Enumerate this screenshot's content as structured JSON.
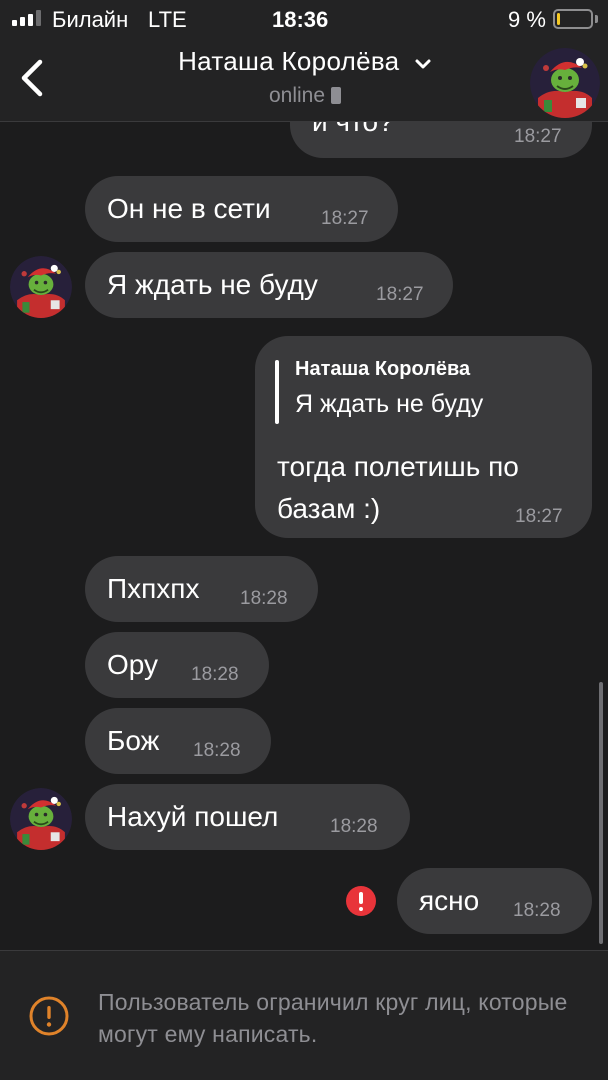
{
  "status_bar": {
    "carrier": "Билайн",
    "network": "LTE",
    "time": "18:36",
    "battery_percent": "9 %",
    "battery_level": 0.09,
    "battery_color": "#f5c924",
    "signal_bars_filled": 3,
    "signal_bars_total": 4
  },
  "header": {
    "back_icon": "chevron-left-icon",
    "title": "Наташа Королёва",
    "title_dropdown_icon": "chevron-down-icon",
    "presence": "online",
    "presence_icon": "phone-icon"
  },
  "messages": [
    {
      "direction": "outgoing",
      "text": "и что?",
      "time": "18:27"
    },
    {
      "direction": "incoming",
      "text": "Он не в сети",
      "time": "18:27"
    },
    {
      "direction": "incoming",
      "text": "Я ждать не буду",
      "time": "18:27",
      "show_avatar": true
    },
    {
      "direction": "outgoing",
      "reply": {
        "author": "Наташа Королёва",
        "text": "Я ждать не буду"
      },
      "text": "тогда полетишь по базам :)",
      "time": "18:27"
    },
    {
      "direction": "incoming",
      "text": "Пхпхпх",
      "time": "18:28"
    },
    {
      "direction": "incoming",
      "text": "Ору",
      "time": "18:28"
    },
    {
      "direction": "incoming",
      "text": "Бож",
      "time": "18:28"
    },
    {
      "direction": "incoming",
      "text": "Нахуй пошел",
      "time": "18:28",
      "show_avatar": true
    },
    {
      "direction": "outgoing",
      "text": "ясно",
      "time": "18:28",
      "status": "failed",
      "status_icon": "error-icon"
    }
  ],
  "footer": {
    "icon": "warning-circle-icon",
    "restriction_text": "Пользователь ограничил круг лиц, которые могут ему написать."
  },
  "colors": {
    "background": "#1c1c1d",
    "bars": "#232324",
    "bubble": "#3a3a3c",
    "error": "#e8343a",
    "warning": "#e0832a",
    "secondary_text": "#8e8e93"
  }
}
